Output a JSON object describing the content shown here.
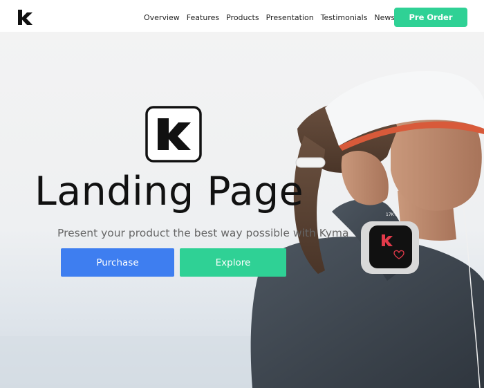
{
  "nav": {
    "brand_icon": "k-logo-icon",
    "links": [
      "Overview",
      "Features",
      "Products",
      "Presentation",
      "Testimonials",
      "News"
    ],
    "preorder_label": "Pre Order"
  },
  "hero": {
    "logo_icon": "k-logo-icon",
    "title": "Landing Page",
    "subtitle": "Present your product the best way possible with Kyma",
    "purchase_label": "Purchase",
    "explore_label": "Explore",
    "watch_text": "17K+"
  },
  "colors": {
    "accent_green": "#2fd195",
    "accent_blue": "#3e7ef0",
    "watch_red": "#e23a4a"
  }
}
